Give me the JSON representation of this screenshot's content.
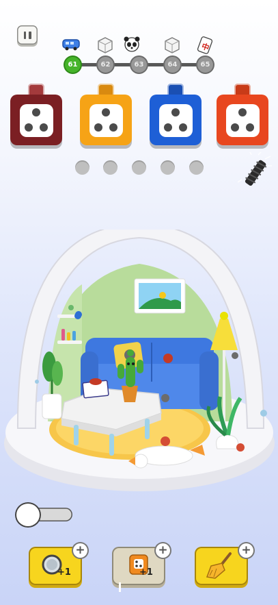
{
  "hud": {
    "levels": [
      "61",
      "62",
      "63",
      "64",
      "65"
    ],
    "current_level": "61",
    "level_icons": [
      "bus-icon",
      "white-cube-icon",
      "panda-icon",
      "white-cube-icon",
      "mahjong-tile-icon"
    ]
  },
  "dice_boxes": [
    {
      "color": "#7b1f23",
      "cap": "#a33a3c",
      "id": "dark-red"
    },
    {
      "color": "#f6a316",
      "cap": "#d98a10",
      "id": "yellow"
    },
    {
      "color": "#1e5fd6",
      "cap": "#1a4fb3",
      "id": "blue"
    },
    {
      "color": "#e8471f",
      "cap": "#c83b18",
      "id": "orange-red"
    }
  ],
  "slots_count": 5,
  "boosters": [
    {
      "name": "magnifier-booster",
      "badge": "+1"
    },
    {
      "name": "extra-box-booster",
      "badge": "+1"
    },
    {
      "name": "broom-booster",
      "badge": ""
    }
  ],
  "colors": {
    "accent": "#46b42a",
    "booster_yellow": "#f7d51e",
    "room_wall": "#b8dc9b",
    "sofa": "#3e78e0",
    "rug": "#f7c64a"
  }
}
